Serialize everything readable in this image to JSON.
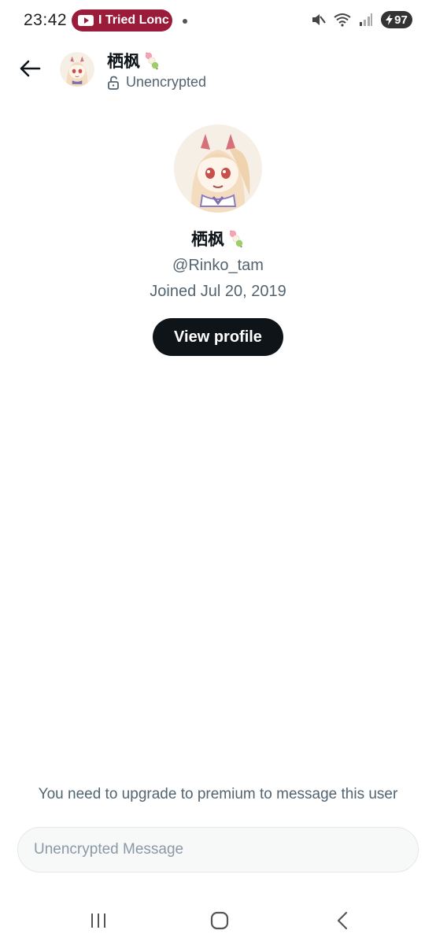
{
  "status_bar": {
    "time": "23:42",
    "media_pill_text": "I Tried Lonc",
    "battery": "97",
    "accent": "#9b1b3a"
  },
  "header": {
    "name": "栖枫",
    "subtitle": "Unencrypted",
    "back_icon": "arrow-left-icon",
    "lock_icon": "unlock-icon"
  },
  "profile": {
    "name": "栖枫",
    "handle": "@Rinko_tam",
    "joined": "Joined Jul 20, 2019",
    "view_profile_label": "View profile"
  },
  "composer": {
    "upgrade_notice": "You need to upgrade to premium to message this user",
    "placeholder": "Unencrypted Message"
  },
  "nav": {
    "recents_icon": "recents-icon",
    "home_icon": "home-icon",
    "back_icon": "back-chevron-icon"
  }
}
